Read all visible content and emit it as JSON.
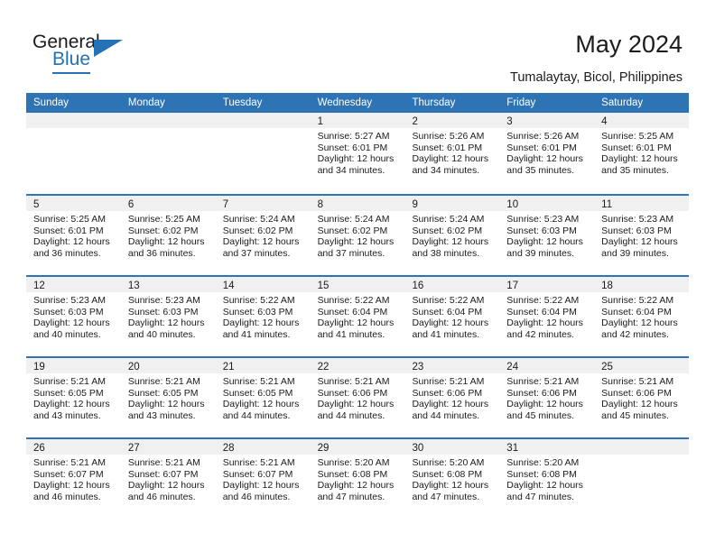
{
  "brand": {
    "name_part1": "General",
    "name_part2": "Blue",
    "accent_color": "#2471b5"
  },
  "header": {
    "title": "May 2024",
    "subtitle": "Tumalaytay, Bicol, Philippines"
  },
  "theme": {
    "header_blue": "#2e74b5",
    "day_band_gray": "#f0f0f0",
    "text_color": "#1b1b1b"
  },
  "weekdays": [
    "Sunday",
    "Monday",
    "Tuesday",
    "Wednesday",
    "Thursday",
    "Friday",
    "Saturday"
  ],
  "weeks": [
    [
      {
        "day": "",
        "sunrise": "",
        "sunset": "",
        "daylight_line1": "",
        "daylight_line2": "",
        "empty": true
      },
      {
        "day": "",
        "sunrise": "",
        "sunset": "",
        "daylight_line1": "",
        "daylight_line2": "",
        "empty": true
      },
      {
        "day": "",
        "sunrise": "",
        "sunset": "",
        "daylight_line1": "",
        "daylight_line2": "",
        "empty": true
      },
      {
        "day": "1",
        "sunrise": "Sunrise: 5:27 AM",
        "sunset": "Sunset: 6:01 PM",
        "daylight_line1": "Daylight: 12 hours",
        "daylight_line2": "and 34 minutes."
      },
      {
        "day": "2",
        "sunrise": "Sunrise: 5:26 AM",
        "sunset": "Sunset: 6:01 PM",
        "daylight_line1": "Daylight: 12 hours",
        "daylight_line2": "and 34 minutes."
      },
      {
        "day": "3",
        "sunrise": "Sunrise: 5:26 AM",
        "sunset": "Sunset: 6:01 PM",
        "daylight_line1": "Daylight: 12 hours",
        "daylight_line2": "and 35 minutes."
      },
      {
        "day": "4",
        "sunrise": "Sunrise: 5:25 AM",
        "sunset": "Sunset: 6:01 PM",
        "daylight_line1": "Daylight: 12 hours",
        "daylight_line2": "and 35 minutes."
      }
    ],
    [
      {
        "day": "5",
        "sunrise": "Sunrise: 5:25 AM",
        "sunset": "Sunset: 6:01 PM",
        "daylight_line1": "Daylight: 12 hours",
        "daylight_line2": "and 36 minutes."
      },
      {
        "day": "6",
        "sunrise": "Sunrise: 5:25 AM",
        "sunset": "Sunset: 6:02 PM",
        "daylight_line1": "Daylight: 12 hours",
        "daylight_line2": "and 36 minutes."
      },
      {
        "day": "7",
        "sunrise": "Sunrise: 5:24 AM",
        "sunset": "Sunset: 6:02 PM",
        "daylight_line1": "Daylight: 12 hours",
        "daylight_line2": "and 37 minutes."
      },
      {
        "day": "8",
        "sunrise": "Sunrise: 5:24 AM",
        "sunset": "Sunset: 6:02 PM",
        "daylight_line1": "Daylight: 12 hours",
        "daylight_line2": "and 37 minutes."
      },
      {
        "day": "9",
        "sunrise": "Sunrise: 5:24 AM",
        "sunset": "Sunset: 6:02 PM",
        "daylight_line1": "Daylight: 12 hours",
        "daylight_line2": "and 38 minutes."
      },
      {
        "day": "10",
        "sunrise": "Sunrise: 5:23 AM",
        "sunset": "Sunset: 6:03 PM",
        "daylight_line1": "Daylight: 12 hours",
        "daylight_line2": "and 39 minutes."
      },
      {
        "day": "11",
        "sunrise": "Sunrise: 5:23 AM",
        "sunset": "Sunset: 6:03 PM",
        "daylight_line1": "Daylight: 12 hours",
        "daylight_line2": "and 39 minutes."
      }
    ],
    [
      {
        "day": "12",
        "sunrise": "Sunrise: 5:23 AM",
        "sunset": "Sunset: 6:03 PM",
        "daylight_line1": "Daylight: 12 hours",
        "daylight_line2": "and 40 minutes."
      },
      {
        "day": "13",
        "sunrise": "Sunrise: 5:23 AM",
        "sunset": "Sunset: 6:03 PM",
        "daylight_line1": "Daylight: 12 hours",
        "daylight_line2": "and 40 minutes."
      },
      {
        "day": "14",
        "sunrise": "Sunrise: 5:22 AM",
        "sunset": "Sunset: 6:03 PM",
        "daylight_line1": "Daylight: 12 hours",
        "daylight_line2": "and 41 minutes."
      },
      {
        "day": "15",
        "sunrise": "Sunrise: 5:22 AM",
        "sunset": "Sunset: 6:04 PM",
        "daylight_line1": "Daylight: 12 hours",
        "daylight_line2": "and 41 minutes."
      },
      {
        "day": "16",
        "sunrise": "Sunrise: 5:22 AM",
        "sunset": "Sunset: 6:04 PM",
        "daylight_line1": "Daylight: 12 hours",
        "daylight_line2": "and 41 minutes."
      },
      {
        "day": "17",
        "sunrise": "Sunrise: 5:22 AM",
        "sunset": "Sunset: 6:04 PM",
        "daylight_line1": "Daylight: 12 hours",
        "daylight_line2": "and 42 minutes."
      },
      {
        "day": "18",
        "sunrise": "Sunrise: 5:22 AM",
        "sunset": "Sunset: 6:04 PM",
        "daylight_line1": "Daylight: 12 hours",
        "daylight_line2": "and 42 minutes."
      }
    ],
    [
      {
        "day": "19",
        "sunrise": "Sunrise: 5:21 AM",
        "sunset": "Sunset: 6:05 PM",
        "daylight_line1": "Daylight: 12 hours",
        "daylight_line2": "and 43 minutes."
      },
      {
        "day": "20",
        "sunrise": "Sunrise: 5:21 AM",
        "sunset": "Sunset: 6:05 PM",
        "daylight_line1": "Daylight: 12 hours",
        "daylight_line2": "and 43 minutes."
      },
      {
        "day": "21",
        "sunrise": "Sunrise: 5:21 AM",
        "sunset": "Sunset: 6:05 PM",
        "daylight_line1": "Daylight: 12 hours",
        "daylight_line2": "and 44 minutes."
      },
      {
        "day": "22",
        "sunrise": "Sunrise: 5:21 AM",
        "sunset": "Sunset: 6:06 PM",
        "daylight_line1": "Daylight: 12 hours",
        "daylight_line2": "and 44 minutes."
      },
      {
        "day": "23",
        "sunrise": "Sunrise: 5:21 AM",
        "sunset": "Sunset: 6:06 PM",
        "daylight_line1": "Daylight: 12 hours",
        "daylight_line2": "and 44 minutes."
      },
      {
        "day": "24",
        "sunrise": "Sunrise: 5:21 AM",
        "sunset": "Sunset: 6:06 PM",
        "daylight_line1": "Daylight: 12 hours",
        "daylight_line2": "and 45 minutes."
      },
      {
        "day": "25",
        "sunrise": "Sunrise: 5:21 AM",
        "sunset": "Sunset: 6:06 PM",
        "daylight_line1": "Daylight: 12 hours",
        "daylight_line2": "and 45 minutes."
      }
    ],
    [
      {
        "day": "26",
        "sunrise": "Sunrise: 5:21 AM",
        "sunset": "Sunset: 6:07 PM",
        "daylight_line1": "Daylight: 12 hours",
        "daylight_line2": "and 46 minutes."
      },
      {
        "day": "27",
        "sunrise": "Sunrise: 5:21 AM",
        "sunset": "Sunset: 6:07 PM",
        "daylight_line1": "Daylight: 12 hours",
        "daylight_line2": "and 46 minutes."
      },
      {
        "day": "28",
        "sunrise": "Sunrise: 5:21 AM",
        "sunset": "Sunset: 6:07 PM",
        "daylight_line1": "Daylight: 12 hours",
        "daylight_line2": "and 46 minutes."
      },
      {
        "day": "29",
        "sunrise": "Sunrise: 5:20 AM",
        "sunset": "Sunset: 6:08 PM",
        "daylight_line1": "Daylight: 12 hours",
        "daylight_line2": "and 47 minutes."
      },
      {
        "day": "30",
        "sunrise": "Sunrise: 5:20 AM",
        "sunset": "Sunset: 6:08 PM",
        "daylight_line1": "Daylight: 12 hours",
        "daylight_line2": "and 47 minutes."
      },
      {
        "day": "31",
        "sunrise": "Sunrise: 5:20 AM",
        "sunset": "Sunset: 6:08 PM",
        "daylight_line1": "Daylight: 12 hours",
        "daylight_line2": "and 47 minutes."
      },
      {
        "day": "",
        "sunrise": "",
        "sunset": "",
        "daylight_line1": "",
        "daylight_line2": "",
        "empty": true
      }
    ]
  ]
}
